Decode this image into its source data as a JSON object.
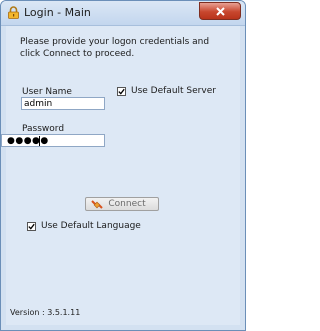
{
  "window": {
    "title": "Login - Main",
    "icons": {
      "app": "lock-icon",
      "close": "close-icon"
    }
  },
  "form": {
    "instructions": "Please provide your logon credentials and click Connect to proceed.",
    "username_label": "User Name",
    "username_value": "admin",
    "password_label": "Password",
    "password_mask": "●●●●●",
    "use_default_server_label": "Use Default Server",
    "use_default_server_checked": true,
    "connect_label": "Connect",
    "connect_icon": "connect-plug-icon",
    "use_default_language_label": "Use Default Language",
    "use_default_language_checked": true
  },
  "footer": {
    "version": "Version : 3.5.1.11"
  },
  "colors": {
    "client_bg": "#dde8f5",
    "close_button": "#c8472e"
  }
}
